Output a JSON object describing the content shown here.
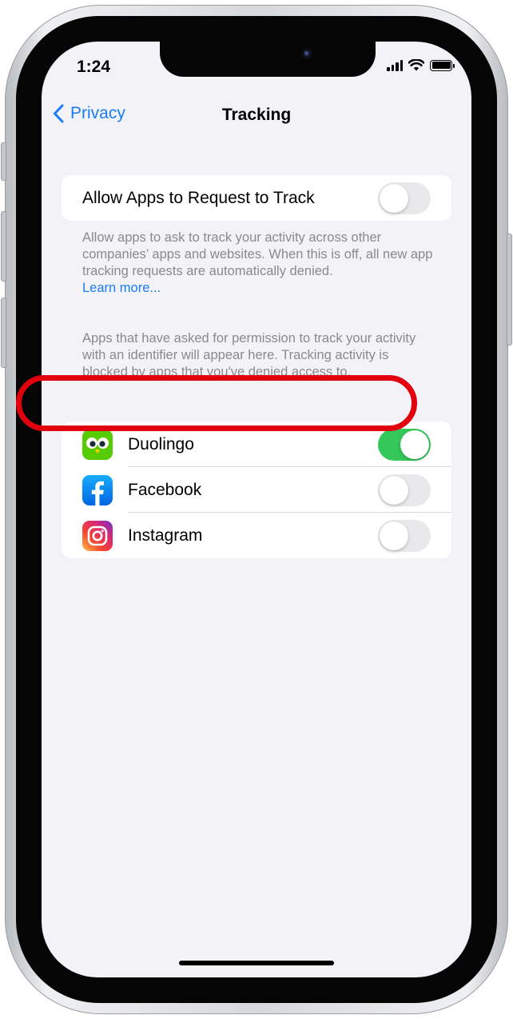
{
  "status_bar": {
    "time": "1:24"
  },
  "nav": {
    "back_label": "Privacy",
    "title": "Tracking"
  },
  "allow_tracking": {
    "label": "Allow Apps to Request to Track",
    "enabled": false,
    "description": "Allow apps to ask to track your activity across other companies’ apps and websites. When this is off, all new app tracking requests are automatically denied.",
    "learn_more": "Learn more..."
  },
  "apps_section": {
    "header": "Apps that have asked for permission to track your activity with an identifier will appear here. Tracking activity is blocked by apps that you've denied access to.",
    "apps": [
      {
        "name": "Duolingo",
        "icon": "duolingo-owl-icon",
        "enabled": true
      },
      {
        "name": "Facebook",
        "icon": "facebook-f-icon",
        "enabled": false
      },
      {
        "name": "Instagram",
        "icon": "instagram-camera-icon",
        "enabled": false
      }
    ]
  },
  "colors": {
    "accent": "#1a7cf5",
    "toggle_on": "#34c759",
    "toggle_off": "#e9e9eb",
    "highlight": "#e3000e",
    "background": "#f2f2f7"
  }
}
